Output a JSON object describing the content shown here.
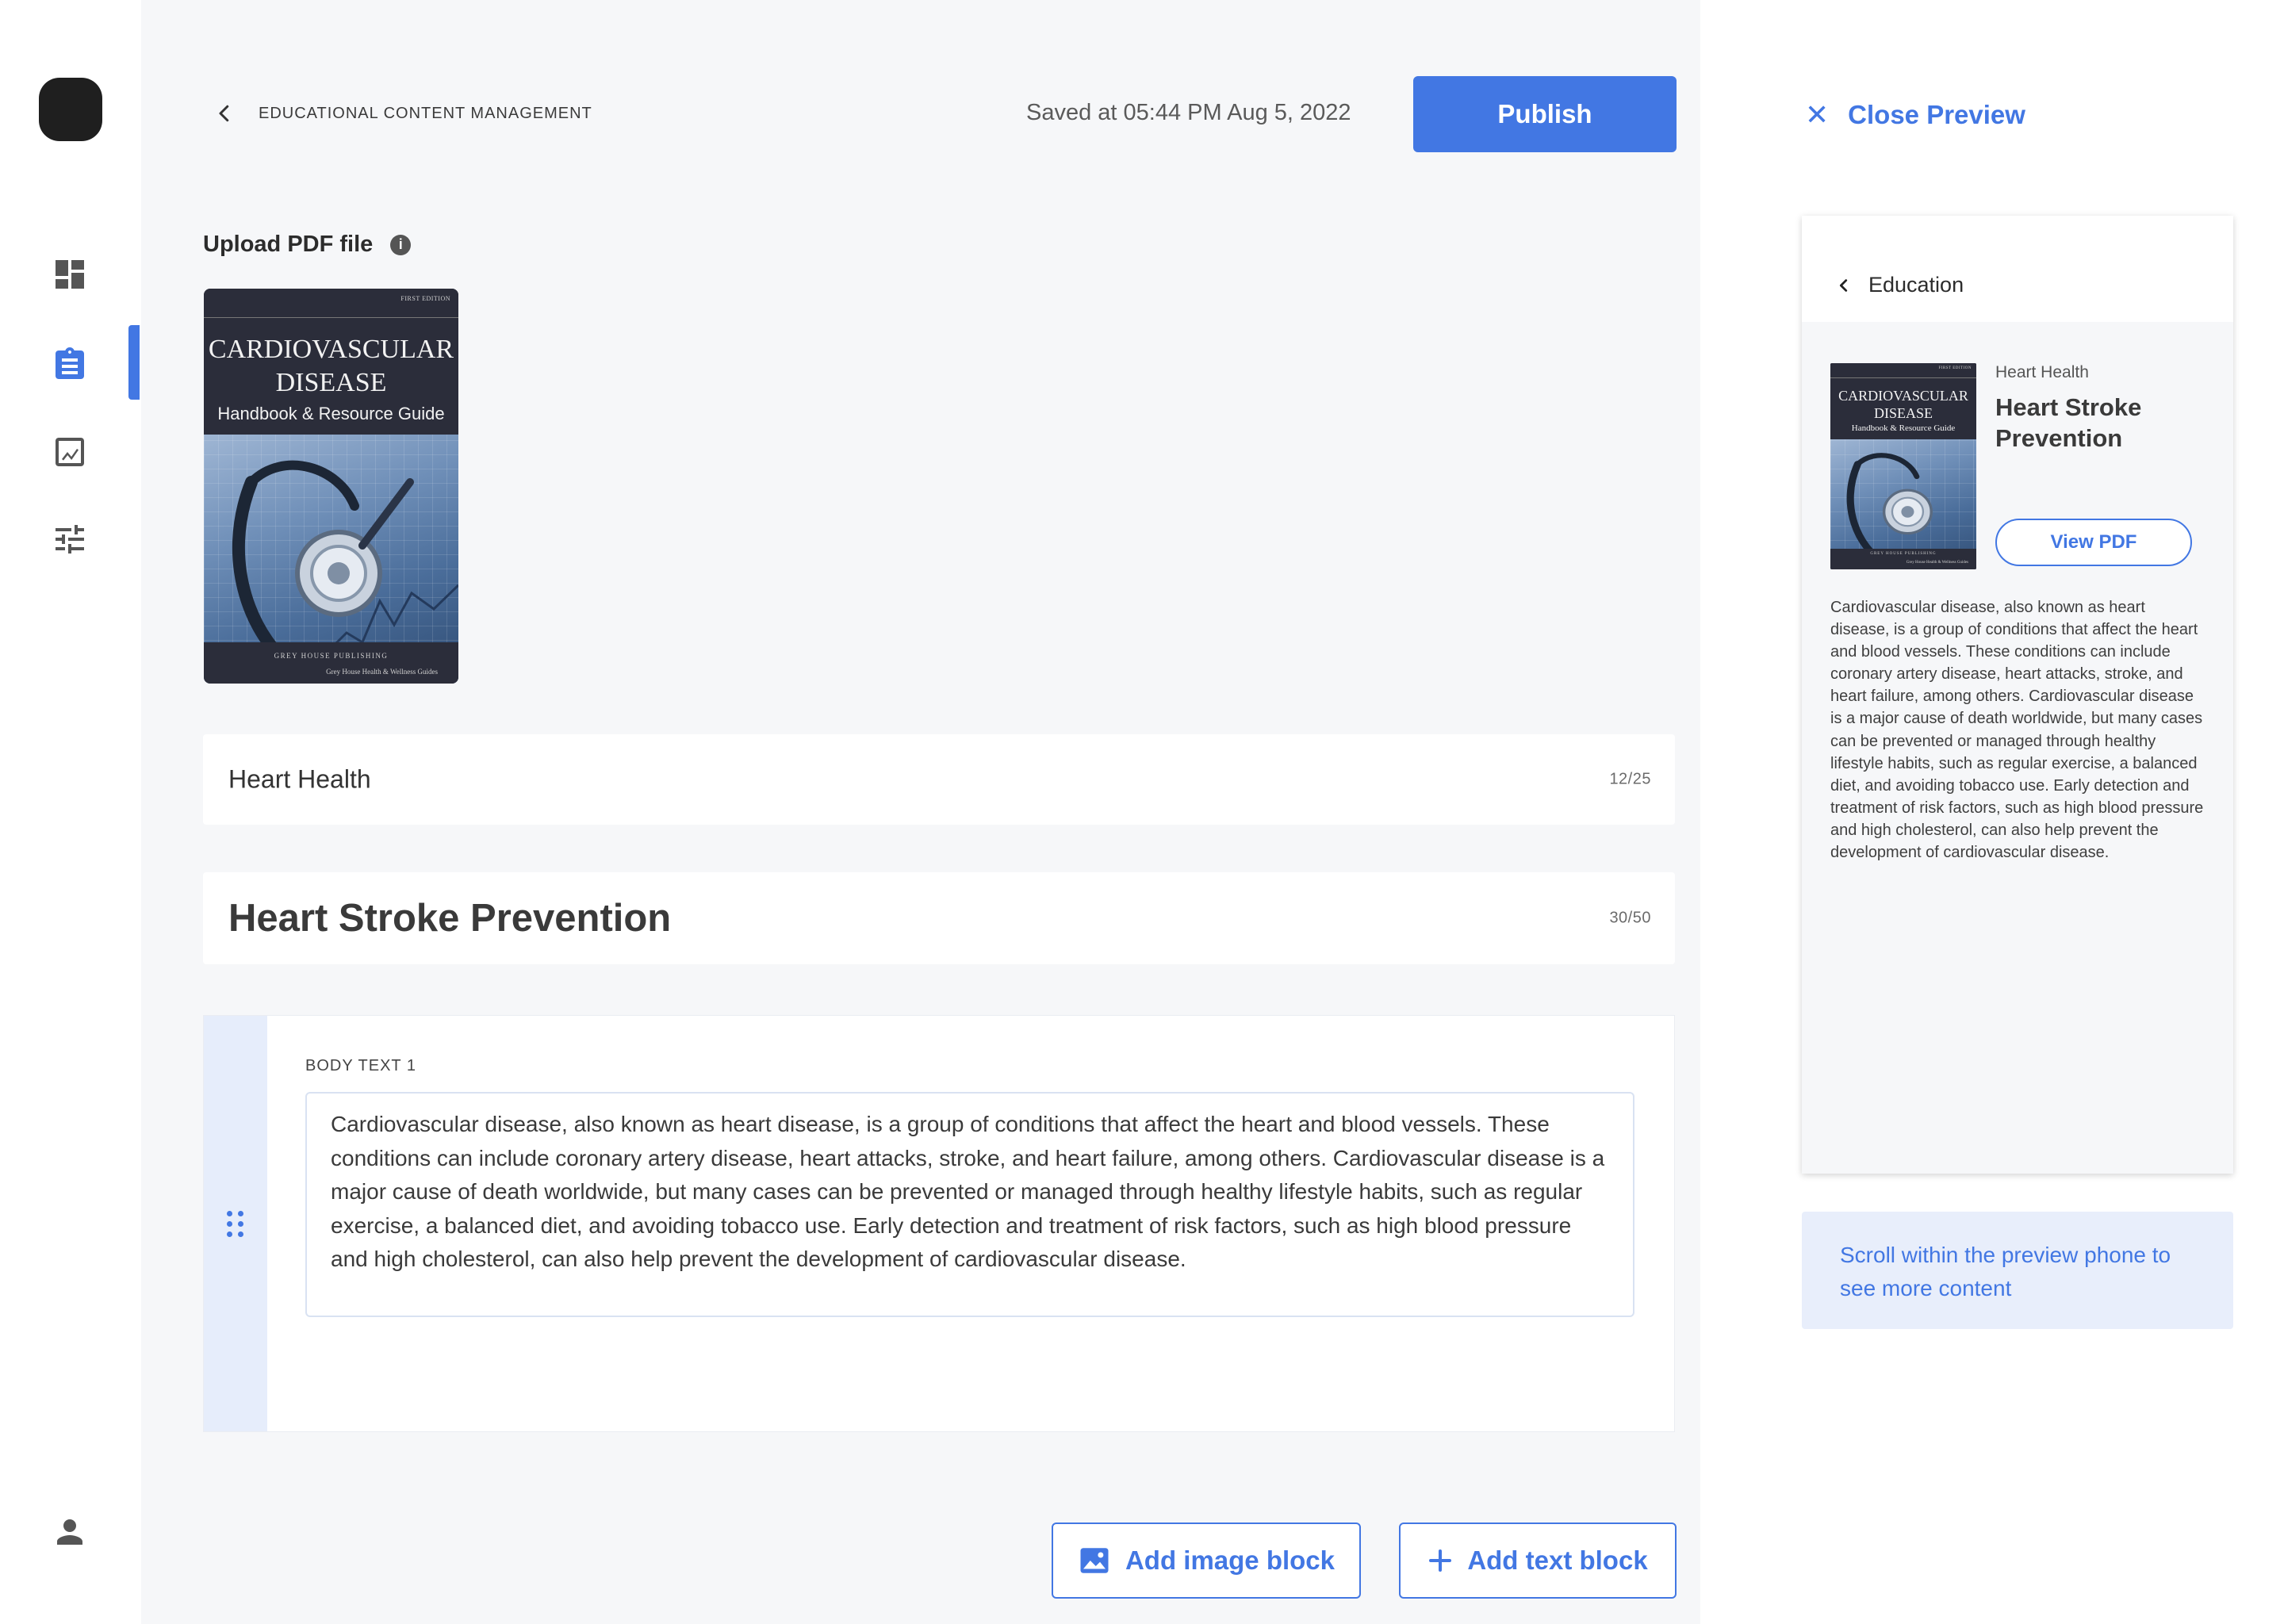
{
  "nav": {
    "items": [
      {
        "name": "dashboard",
        "icon": "dashboard-icon",
        "active": false
      },
      {
        "name": "content",
        "icon": "clipboard-icon",
        "active": true
      },
      {
        "name": "analytics",
        "icon": "chart-icon",
        "active": false
      },
      {
        "name": "settings",
        "icon": "sliders-icon",
        "active": false
      }
    ],
    "profile_icon": "person-icon"
  },
  "header": {
    "breadcrumb": "EDUCATIONAL CONTENT MANAGEMENT",
    "saved_text": "Saved at 05:44 PM Aug 5, 2022",
    "publish_label": "Publish"
  },
  "upload": {
    "label": "Upload PDF file",
    "info_glyph": "i"
  },
  "book": {
    "edition": "FIRST EDITION",
    "title_line1": "CARDIOVASCULAR",
    "title_line2": "DISEASE",
    "subtitle": "Handbook & Resource Guide",
    "publisher": "GREY HOUSE PUBLISHING",
    "series": "Grey House Health & Wellness Guides"
  },
  "category_field": {
    "value": "Heart Health",
    "count": "12/25"
  },
  "title_field": {
    "value": "Heart Stroke Prevention",
    "count": "30/50"
  },
  "body_block": {
    "label": "BODY TEXT 1",
    "text": "Cardiovascular disease, also known as heart disease, is a group of conditions that affect the heart and blood vessels. These conditions can include coronary artery disease, heart attacks, stroke, and heart failure, among others. Cardiovascular disease is a major cause of death worldwide, but many cases can be prevented or managed through healthy lifestyle habits, such as regular exercise, a balanced diet, and avoiding tobacco use. Early detection and treatment of risk factors, such as high blood pressure and high cholesterol, can also help prevent the development of cardiovascular disease."
  },
  "actions": {
    "add_image_label": "Add image block",
    "add_text_label": "Add text block"
  },
  "preview": {
    "close_label": "Close Preview",
    "close_glyph": "✕",
    "back_label": "Education",
    "category": "Heart Health",
    "title": "Heart Stroke Prevention",
    "view_pdf_label": "View PDF",
    "body": "Cardiovascular disease, also known as heart disease, is a group of conditions that affect the heart and blood vessels. These conditions can include coronary artery disease, heart attacks, stroke, and heart failure, among others. Cardiovascular disease is a major cause of death worldwide, but many cases can be prevented or managed through healthy lifestyle habits, such as regular exercise, a balanced diet, and avoiding tobacco use. Early detection and treatment of risk factors, such as high blood pressure and high cholesterol, can also help prevent the development of cardiovascular disease.",
    "scroll_hint": "Scroll within the preview phone to see more content"
  },
  "colors": {
    "accent": "#4277e3",
    "main_bg": "#f6f7f9",
    "handle_bg": "#e6edfb",
    "book_dark": "#2b2d3a"
  }
}
